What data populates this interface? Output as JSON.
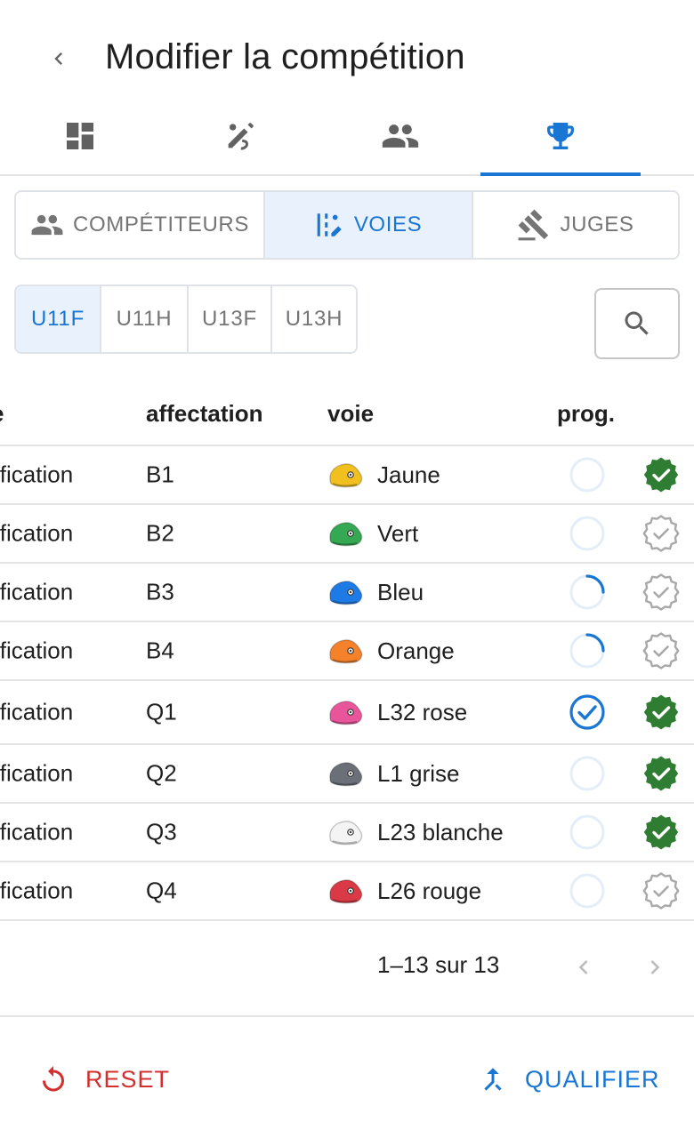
{
  "header": {
    "title": "Modifier la compétition",
    "back_icon": "chevron-left-icon"
  },
  "icon_tabs": [
    {
      "icon": "dashboard-icon",
      "active": false
    },
    {
      "icon": "edit-routes-icon",
      "active": false
    },
    {
      "icon": "people-icon",
      "active": false
    },
    {
      "icon": "trophy-icon",
      "active": true
    }
  ],
  "segments": {
    "competitors": "COMPÉTITEURS",
    "routes": "VOIES",
    "judges": "JUGES",
    "selected": "VOIES"
  },
  "categories": {
    "items": [
      "U11F",
      "U11H",
      "U13F",
      "U13H"
    ],
    "selected": "U11F"
  },
  "table": {
    "headers": {
      "col_a": "e",
      "affectation": "affectation",
      "voie": "voie",
      "prog": "prog."
    },
    "rows": [
      {
        "phase": "ification",
        "affectation": "B1",
        "voie": "Jaune",
        "hold_color": "#f2c01e",
        "progress": "empty",
        "validated": true
      },
      {
        "phase": "ification",
        "affectation": "B2",
        "voie": "Vert",
        "hold_color": "#34a853",
        "progress": "empty",
        "validated": false
      },
      {
        "phase": "ification",
        "affectation": "B3",
        "voie": "Bleu",
        "hold_color": "#1e7be6",
        "progress": "partial",
        "validated": false
      },
      {
        "phase": "ification",
        "affectation": "B4",
        "voie": "Orange",
        "hold_color": "#f5822a",
        "progress": "partial",
        "validated": false
      },
      {
        "phase": "ification",
        "affectation": "Q1",
        "voie": "L32 rose",
        "hold_color": "#e8559a",
        "progress": "done",
        "validated": true
      },
      {
        "phase": "ification",
        "affectation": "Q2",
        "voie": "L1 grise",
        "hold_color": "#6b6f78",
        "progress": "empty",
        "validated": true
      },
      {
        "phase": "ification",
        "affectation": "Q3",
        "voie": "L23 blanche",
        "hold_color": "#f4f4f4",
        "progress": "empty",
        "validated": true
      },
      {
        "phase": "ification",
        "affectation": "Q4",
        "voie": "L26 rouge",
        "hold_color": "#d93a45",
        "progress": "empty",
        "validated": false
      }
    ]
  },
  "pagination": {
    "label": "1–13 sur 13"
  },
  "actions": {
    "reset": "RESET",
    "qualify": "QUALIFIER"
  },
  "colors": {
    "accent": "#1976d2",
    "danger": "#d32f2f",
    "validated": "#2e7d32",
    "muted": "#9e9e9e"
  }
}
